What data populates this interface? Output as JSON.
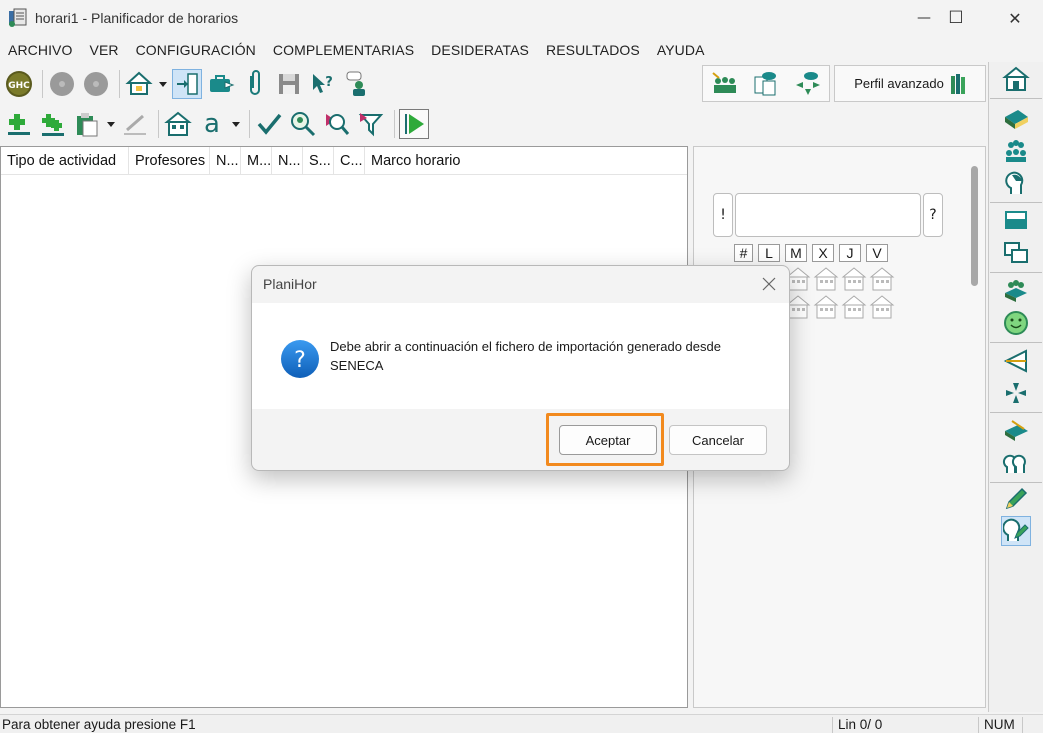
{
  "window": {
    "title": "horari1 - Planificador de horarios",
    "minimize_glyph": "—",
    "maximize_glyph": "☐",
    "close_glyph": "✕"
  },
  "menu": [
    "ARCHIVO",
    "VER",
    "CONFIGURACIÓN",
    "COMPLEMENTARIAS",
    "DESIDERATAS",
    "RESULTADOS",
    "AYUDA"
  ],
  "toolbar1": {
    "ghc_label": "GHC"
  },
  "toolbar2": {
    "font_label": "a"
  },
  "perfil": {
    "label": "Perfil avanzado"
  },
  "list": {
    "columns": [
      "Tipo de actividad",
      "Profesores",
      "N...",
      "M...",
      "N...",
      "S...",
      "C...",
      "Marco horario"
    ]
  },
  "right_panel": {
    "left_key": "!",
    "right_key": "?",
    "days": [
      "#",
      "L",
      "M",
      "X",
      "J",
      "V"
    ]
  },
  "status": {
    "help": "Para obtener ayuda presione F1",
    "position": "Lin 0/ 0",
    "numlock": "NUM"
  },
  "dialog": {
    "title": "PlaniHor",
    "message": "Debe abrir a continuación el fichero de importación generado desde SENECA",
    "accept": "Aceptar",
    "cancel": "Cancelar",
    "question_glyph": "?"
  },
  "colors": {
    "accent": "#1a78d6",
    "highlight": "#f28a1e",
    "icon_green": "#2e8b57",
    "icon_teal": "#0a8a8a"
  }
}
